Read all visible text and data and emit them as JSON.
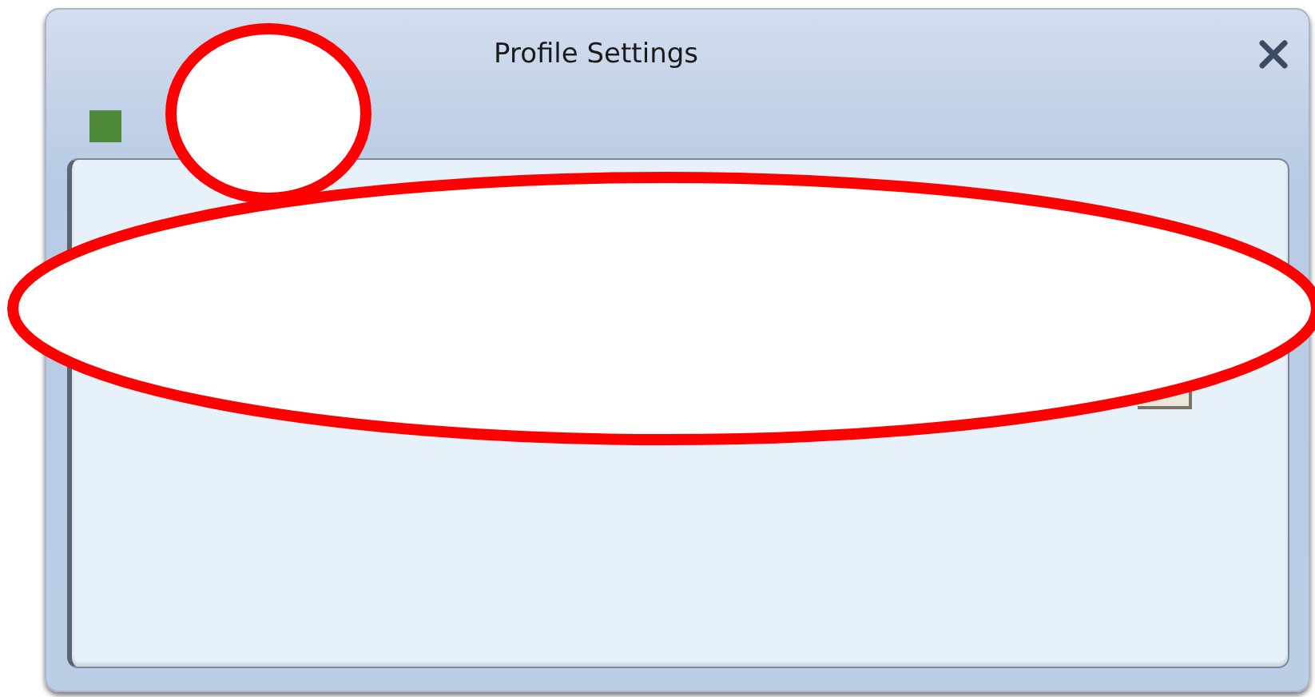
{
  "window": {
    "title": "Profile Settings"
  }
}
